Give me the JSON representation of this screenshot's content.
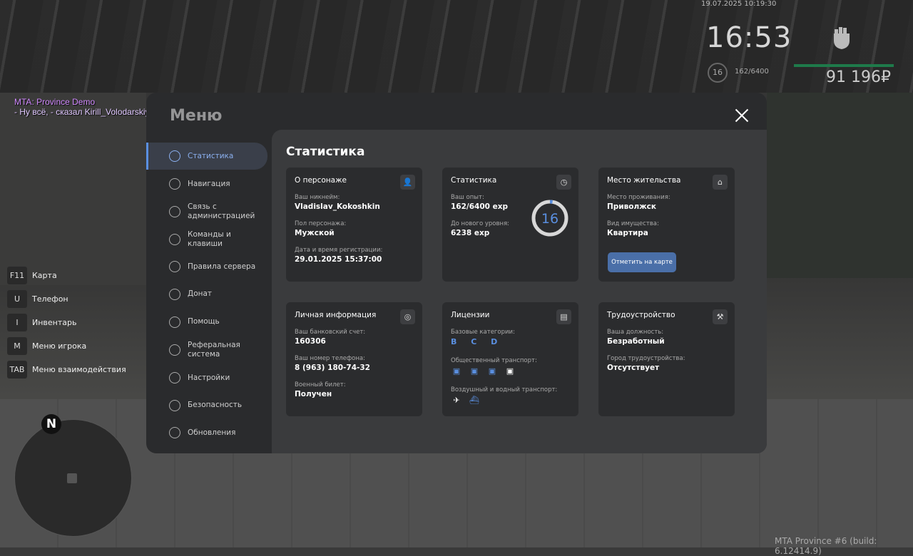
{
  "hud": {
    "datetime": "19.07.2025 10:19:30",
    "clock": "16:53",
    "level": "16",
    "exp": "162/6400",
    "money": "91 196₽"
  },
  "chat": {
    "line1": "MTA: Province Demo",
    "line2": "- Ну всё, - сказал Kirill_Volodarskiy, улыбнувшись."
  },
  "hotkeys": [
    {
      "key": "F11",
      "label": "Карта"
    },
    {
      "key": "U",
      "label": "Телефон"
    },
    {
      "key": "I",
      "label": "Инвентарь"
    },
    {
      "key": "M",
      "label": "Меню игрока"
    },
    {
      "key": "TAB",
      "label": "Меню взаимодействия"
    }
  ],
  "minimap": {
    "north": "N"
  },
  "build": "MTA Province #6 (build: 6.12414.9)",
  "menu": {
    "title": "Меню",
    "nav": [
      {
        "label": "Статистика",
        "icon": "pie-chart-icon"
      },
      {
        "label": "Навигация",
        "icon": "compass-icon"
      },
      {
        "label": "Связь с администрацией",
        "icon": "headset-icon"
      },
      {
        "label": "Команды и клавиши",
        "icon": "keyboard-icon"
      },
      {
        "label": "Правила сервера",
        "icon": "scales-icon"
      },
      {
        "label": "Донат",
        "icon": "wallet-icon"
      },
      {
        "label": "Помощь",
        "icon": "handshake-icon"
      },
      {
        "label": "Реферальная система",
        "icon": "referral-icon"
      },
      {
        "label": "Настройки",
        "icon": "gear-icon"
      },
      {
        "label": "Безопасность",
        "icon": "shield-icon"
      },
      {
        "label": "Обновления",
        "icon": "refresh-icon"
      }
    ],
    "active_nav": "Статистика"
  },
  "page": {
    "title": "Статистика",
    "character": {
      "title": "О персонаже",
      "nick_label": "Ваш никнейм:",
      "nick": "Vladislav_Kokoshkin",
      "gender_label": "Пол персонажа:",
      "gender": "Мужской",
      "reg_label": "Дата и время регистрации:",
      "reg": "29.01.2025 15:37:00"
    },
    "stats": {
      "title": "Статистика",
      "exp_label": "Ваш опыт:",
      "exp": "162/6400 exp",
      "next_label": "До нового уровня:",
      "next": "6238 exp",
      "level": "16",
      "progress": 0.025
    },
    "residence": {
      "title": "Место жительства",
      "place_label": "Место проживания:",
      "place": "Приволжск",
      "type_label": "Вид имущества:",
      "type": "Квартира",
      "button": "Отметить на карте"
    },
    "personal": {
      "title": "Личная информация",
      "bank_label": "Ваш банковский счет:",
      "bank": "160306",
      "phone_label": "Ваш номер телефона:",
      "phone": "8 (963) 180-74-32",
      "mil_label": "Военный билет:",
      "mil": "Получен"
    },
    "licenses": {
      "title": "Лицензии",
      "base_label": "Базовые категории:",
      "base": "B C D",
      "public_label": "Общественный транспорт:",
      "air_label": "Воздушный и водный транспорт:"
    },
    "job": {
      "title": "Трудоустройство",
      "position_label": "Ваша должность:",
      "position": "Безработный",
      "city_label": "Город трудоустройства:",
      "city": "Отсутствует"
    }
  }
}
